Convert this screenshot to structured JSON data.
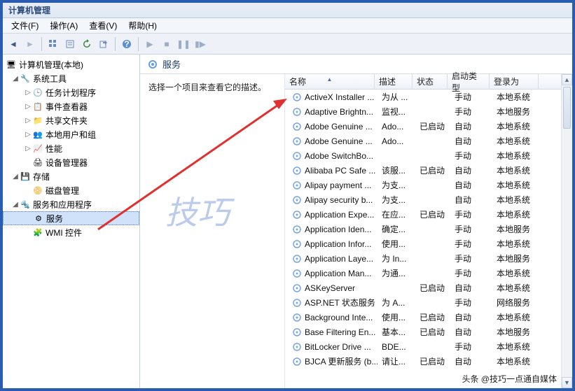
{
  "window": {
    "title": "计算机管理"
  },
  "menu": {
    "file": "文件(F)",
    "action": "操作(A)",
    "view": "查看(V)",
    "help": "帮助(H)"
  },
  "tree": {
    "root": "计算机管理(本地)",
    "grp1": "系统工具",
    "task": "任务计划程序",
    "event": "事件查看器",
    "shared": "共享文件夹",
    "users": "本地用户和组",
    "perf": "性能",
    "devmgr": "设备管理器",
    "grp2": "存储",
    "disk": "磁盘管理",
    "grp3": "服务和应用程序",
    "services": "服务",
    "wmi": "WMI 控件"
  },
  "panel": {
    "title": "服务",
    "hint": "选择一个项目来查看它的描述。"
  },
  "columns": {
    "name": "名称",
    "desc": "描述",
    "status": "状态",
    "startup": "启动类型",
    "logon": "登录为"
  },
  "services": [
    {
      "name": "ActiveX Installer ...",
      "desc": "为从 ...",
      "status": "",
      "startup": "手动",
      "logon": "本地系统"
    },
    {
      "name": "Adaptive Brightn...",
      "desc": "监视...",
      "status": "",
      "startup": "手动",
      "logon": "本地服务"
    },
    {
      "name": "Adobe Genuine ...",
      "desc": "Ado...",
      "status": "已启动",
      "startup": "自动",
      "logon": "本地系统"
    },
    {
      "name": "Adobe Genuine ...",
      "desc": "Ado...",
      "status": "",
      "startup": "自动",
      "logon": "本地系统"
    },
    {
      "name": "Adobe SwitchBo...",
      "desc": "",
      "status": "",
      "startup": "手动",
      "logon": "本地系统"
    },
    {
      "name": "Alibaba PC Safe ...",
      "desc": "该服...",
      "status": "已启动",
      "startup": "自动",
      "logon": "本地系统"
    },
    {
      "name": "Alipay payment ...",
      "desc": "为支...",
      "status": "",
      "startup": "自动",
      "logon": "本地系统"
    },
    {
      "name": "Alipay security b...",
      "desc": "为支...",
      "status": "",
      "startup": "自动",
      "logon": "本地系统"
    },
    {
      "name": "Application Expe...",
      "desc": "在应...",
      "status": "已启动",
      "startup": "手动",
      "logon": "本地系统"
    },
    {
      "name": "Application Iden...",
      "desc": "确定...",
      "status": "",
      "startup": "手动",
      "logon": "本地服务"
    },
    {
      "name": "Application Infor...",
      "desc": "使用...",
      "status": "",
      "startup": "手动",
      "logon": "本地系统"
    },
    {
      "name": "Application Laye...",
      "desc": "为 In...",
      "status": "",
      "startup": "手动",
      "logon": "本地服务"
    },
    {
      "name": "Application Man...",
      "desc": "为通...",
      "status": "",
      "startup": "手动",
      "logon": "本地系统"
    },
    {
      "name": "ASKeyServer",
      "desc": "",
      "status": "已启动",
      "startup": "自动",
      "logon": "本地系统"
    },
    {
      "name": "ASP.NET 状态服务",
      "desc": "为 A...",
      "status": "",
      "startup": "手动",
      "logon": "网络服务"
    },
    {
      "name": "Background Inte...",
      "desc": "使用...",
      "status": "已启动",
      "startup": "自动",
      "logon": "本地系统"
    },
    {
      "name": "Base Filtering En...",
      "desc": "基本...",
      "status": "已启动",
      "startup": "自动",
      "logon": "本地服务"
    },
    {
      "name": "BitLocker Drive ...",
      "desc": "BDE...",
      "status": "",
      "startup": "手动",
      "logon": "本地系统"
    },
    {
      "name": "BJCA 更新服务 (b...",
      "desc": "请让...",
      "status": "已启动",
      "startup": "自动",
      "logon": "本地系统"
    }
  ],
  "watermark": "技巧",
  "credit": "头条 @技巧一点通自媒体"
}
